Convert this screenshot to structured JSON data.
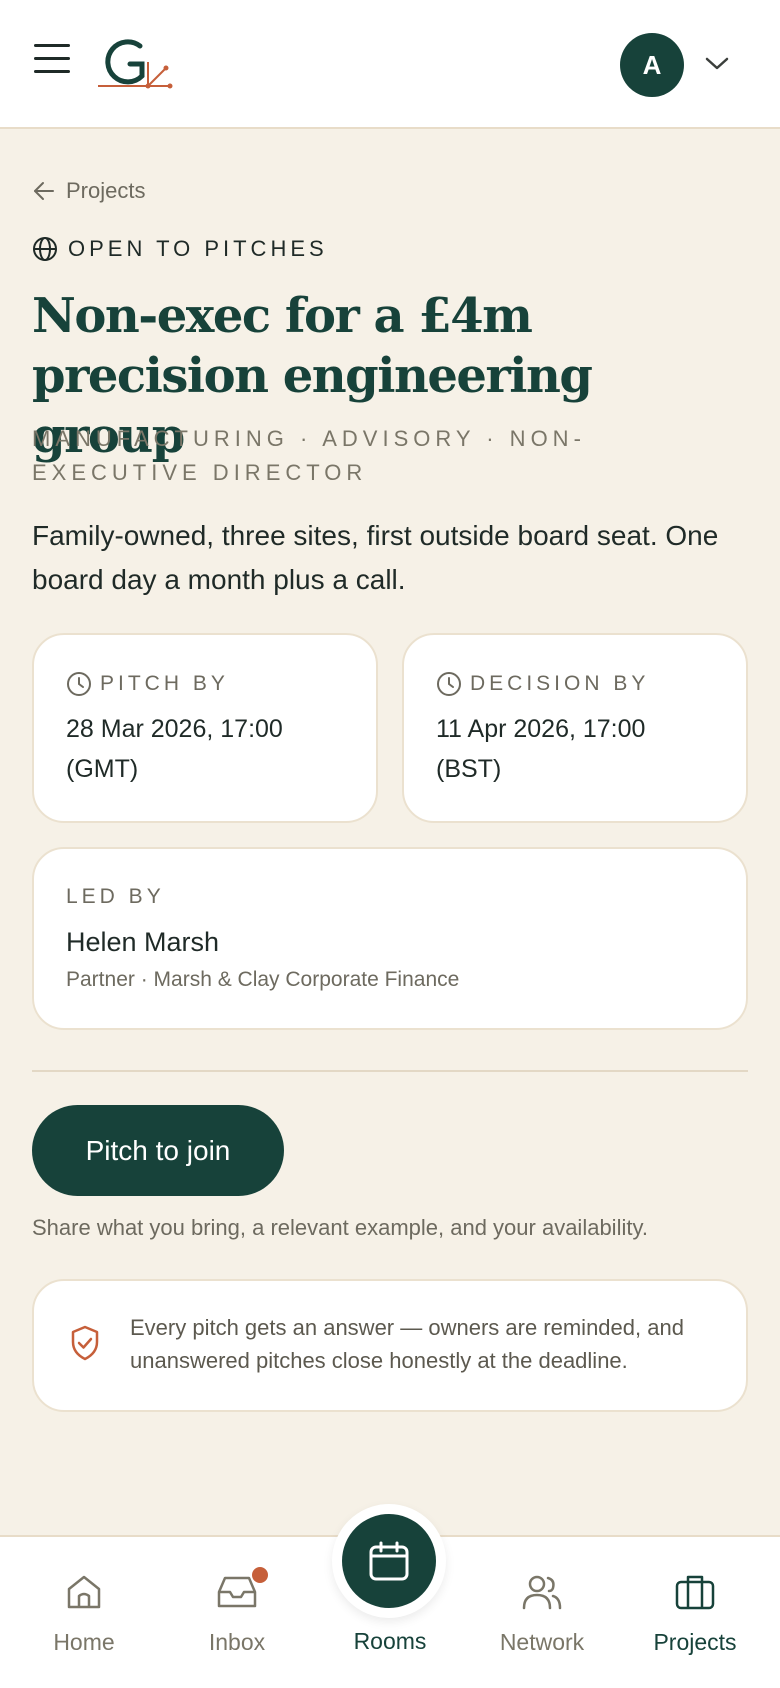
{
  "header": {
    "avatar_initial": "A",
    "icons": [
      "menu-icon",
      "logo",
      "chevron-down-icon"
    ]
  },
  "breadcrumb": {
    "back_label": "Projects"
  },
  "status": {
    "label": "OPEN TO PITCHES"
  },
  "project": {
    "title": "Non-exec for a £4m precision engineering group",
    "tags": "MANUFACTURING · ADVISORY · NON-EXECUTIVE DIRECTOR",
    "description": "Family-owned, three sites, first outside board seat. One board day a month plus a call."
  },
  "dates": {
    "pitch_label": "PITCH BY",
    "pitch_value": "28 Mar 2026, 17:00 (GMT)",
    "decision_label": "DECISION BY",
    "decision_value": "11 Apr 2026, 17:00 (BST)"
  },
  "lead": {
    "label": "LED BY",
    "name": "Helen Marsh",
    "role": "Partner · Marsh & Clay Corporate Finance"
  },
  "cta": {
    "button_label": "Pitch to join",
    "hint": "Share what you bring, a relevant example, and your availability."
  },
  "notice": {
    "text": "Every pitch gets an answer — owners are reminded, and unanswered pitches close honestly at the deadline."
  },
  "nav": {
    "home": "Home",
    "inbox": "Inbox",
    "rooms": "Rooms",
    "network": "Network",
    "projects": "Projects",
    "active": "projects"
  },
  "colors": {
    "brand_green": "#17423a",
    "accent_orange": "#c65f3a",
    "background": "#f6f1e7"
  }
}
